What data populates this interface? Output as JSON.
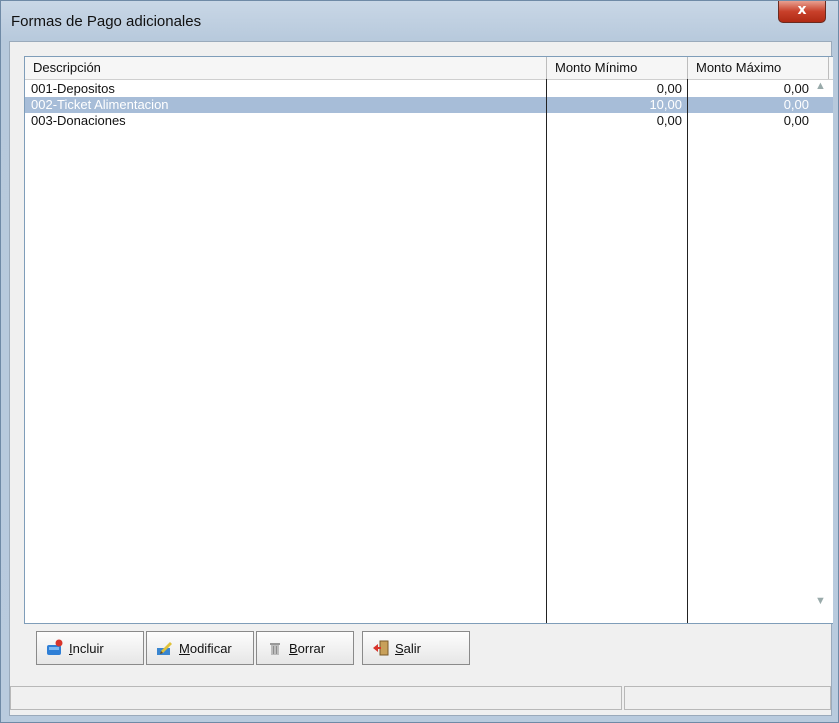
{
  "window": {
    "title": "Formas de Pago adicionales",
    "close_label": "x"
  },
  "grid": {
    "columns": [
      "Descripción",
      "Monto Mínimo",
      "Monto Máximo"
    ],
    "rows": [
      {
        "descripcion": "001-Depositos",
        "minimo": "0,00",
        "maximo": "0,00"
      },
      {
        "descripcion": "002-Ticket Alimentacion",
        "minimo": "10,00",
        "maximo": "0,00"
      },
      {
        "descripcion": "003-Donaciones",
        "minimo": "0,00",
        "maximo": "0,00"
      }
    ],
    "selected_row": 1,
    "scroll_up_glyph": "▲",
    "scroll_down_glyph": "▼"
  },
  "buttons": {
    "incluir": "Incluir",
    "modificar": "Modificar",
    "borrar": "Borrar",
    "salir": "Salir"
  },
  "icons": {
    "incluir": "add-record-icon",
    "modificar": "edit-pencil-icon",
    "borrar": "trash-icon",
    "salir": "exit-door-icon"
  },
  "colors": {
    "selection": "#a7bdd8",
    "title_bg": "#c9d7e6",
    "close_button": "#c8402a"
  }
}
